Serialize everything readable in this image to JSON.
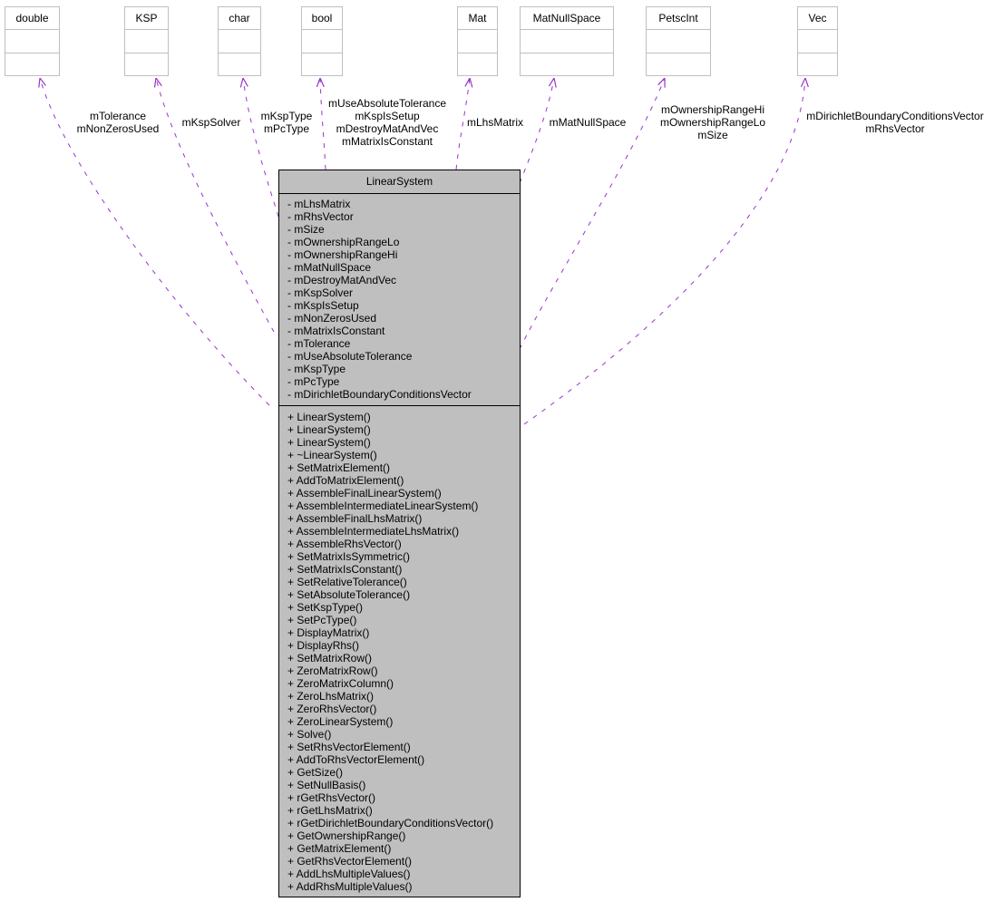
{
  "colors": {
    "edge": "#9a32cd",
    "main_box_fill": "#bfbfbf",
    "main_box_border": "#000000",
    "dependency_box_border": "#bfbfbf"
  },
  "main_class": {
    "name": "LinearSystem",
    "attributes": [
      "- mLhsMatrix",
      "- mRhsVector",
      "- mSize",
      "- mOwnershipRangeLo",
      "- mOwnershipRangeHi",
      "- mMatNullSpace",
      "- mDestroyMatAndVec",
      "- mKspSolver",
      "- mKspIsSetup",
      "- mNonZerosUsed",
      "- mMatrixIsConstant",
      "- mTolerance",
      "- mUseAbsoluteTolerance",
      "- mKspType",
      "- mPcType",
      "- mDirichletBoundaryConditionsVector"
    ],
    "methods": [
      "+ LinearSystem()",
      "+ LinearSystem()",
      "+ LinearSystem()",
      "+ ~LinearSystem()",
      "+ SetMatrixElement()",
      "+ AddToMatrixElement()",
      "+ AssembleFinalLinearSystem()",
      "+ AssembleIntermediateLinearSystem()",
      "+ AssembleFinalLhsMatrix()",
      "+ AssembleIntermediateLhsMatrix()",
      "+ AssembleRhsVector()",
      "+ SetMatrixIsSymmetric()",
      "+ SetMatrixIsConstant()",
      "+ SetRelativeTolerance()",
      "+ SetAbsoluteTolerance()",
      "+ SetKspType()",
      "+ SetPcType()",
      "+ DisplayMatrix()",
      "+ DisplayRhs()",
      "+ SetMatrixRow()",
      "+ ZeroMatrixRow()",
      "+ ZeroMatrixColumn()",
      "+ ZeroLhsMatrix()",
      "+ ZeroRhsVector()",
      "+ ZeroLinearSystem()",
      "+ Solve()",
      "+ SetRhsVectorElement()",
      "+ AddToRhsVectorElement()",
      "+ GetSize()",
      "+ SetNullBasis()",
      "+ rGetRhsVector()",
      "+ rGetLhsMatrix()",
      "+ rGetDirichletBoundaryConditionsVector()",
      "+ GetOwnershipRange()",
      "+ GetMatrixElement()",
      "+ GetRhsVectorElement()",
      "+ AddLhsMultipleValues()",
      "+ AddRhsMultipleValues()"
    ]
  },
  "dependencies": [
    {
      "type": "double",
      "labels": [
        "mTolerance",
        "mNonZerosUsed"
      ]
    },
    {
      "type": "KSP",
      "labels": [
        "mKspSolver"
      ]
    },
    {
      "type": "char",
      "labels": [
        "mKspType",
        "mPcType"
      ]
    },
    {
      "type": "bool",
      "labels": [
        "mUseAbsoluteTolerance",
        "mKspIsSetup",
        "mDestroyMatAndVec",
        "mMatrixIsConstant"
      ]
    },
    {
      "type": "Mat",
      "labels": [
        "mLhsMatrix"
      ]
    },
    {
      "type": "MatNullSpace",
      "labels": [
        "mMatNullSpace"
      ]
    },
    {
      "type": "PetscInt",
      "labels": [
        "mOwnershipRangeHi",
        "mOwnershipRangeLo",
        "mSize"
      ]
    },
    {
      "type": "Vec",
      "labels": [
        "mDirichletBoundaryConditionsVector",
        "mRhsVector"
      ]
    }
  ]
}
